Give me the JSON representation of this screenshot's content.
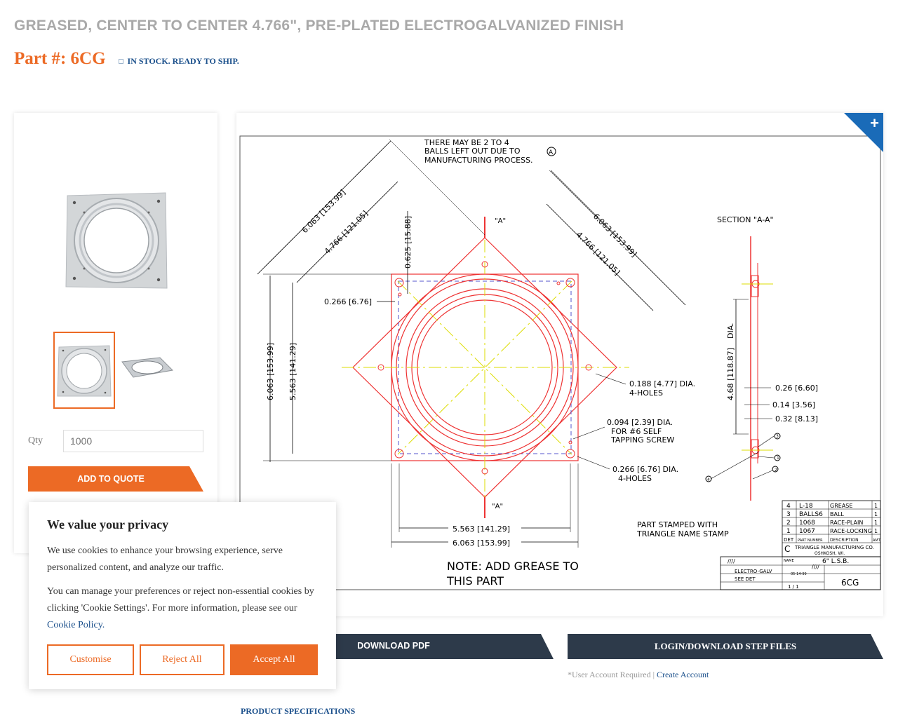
{
  "product": {
    "title": "GREASED, CENTER TO CENTER 4.766\", PRE-PLATED ELECTROGALVANIZED FINISH",
    "part_number": "Part #: 6CG",
    "stock_status": "IN STOCK. READY TO SHIP."
  },
  "purchase": {
    "qty_label": "Qty",
    "qty_placeholder": "1000",
    "quote_button": "ADD TO QUOTE"
  },
  "drawing": {
    "zoom_icon": "plus-icon",
    "note_top": [
      "THERE MAY BE 2 TO 4",
      "BALLS LEFT OUT DUE TO",
      "MANUFACTURING PROCESS."
    ],
    "note_top_ref": "A",
    "dim_6063_a": "6.063 [153.99]",
    "dim_4766_a": "4.766 [121.05]",
    "dim_0625": "0.625 [15.88]",
    "dim_6063_b": "6.063 [153.99]",
    "dim_4766_b": "4.766 [121.05]",
    "section_label": "SECTION \"A-A\"",
    "section_marker": "\"A\"",
    "dim_0266_left": "0.266 [6.76]",
    "dim_6063_v": "6.063 [153.99]",
    "dim_5563_v": "5.563 [141.29]",
    "dim_468": "4.68 [118.87]",
    "dia_label": "DIA.",
    "dim_026": "0.26 [6.60]",
    "dim_014": "0.14 [3.56]",
    "dim_032": "0.32 [8.13]",
    "hole_0188": [
      "0.188 [4.77] DIA.",
      "4-HOLES"
    ],
    "hole_0094": [
      "0.094 [2.39] DIA.",
      "FOR #6 SELF",
      "TAPPING SCREW"
    ],
    "hole_0266": [
      "0.266 [6.76] DIA.",
      "4-HOLES"
    ],
    "dim_5563_h": "5.563 [141.29]",
    "dim_6063_h": "6.063 [153.99]",
    "stamp_note": [
      "PART STAMPED WITH",
      "TRIANGLE NAME STAMP"
    ],
    "grease_note": [
      "NOTE: ADD GREASE TO",
      "THIS PART"
    ],
    "balloons": [
      "1",
      "2",
      "3",
      "4"
    ],
    "bom": [
      {
        "det": "4",
        "part": "L-18",
        "desc": "GREASE",
        "amt": "1"
      },
      {
        "det": "3",
        "part": "BALLS6",
        "desc": "BALL",
        "amt": "1"
      },
      {
        "det": "2",
        "part": "1068",
        "desc": "RACE-PLAIN",
        "amt": "1"
      },
      {
        "det": "1",
        "part": "1067",
        "desc": "RACE-LOCKING",
        "amt": "1"
      }
    ],
    "bom_headers": [
      "DET",
      "PART NUMBER",
      "DESCRIPTION",
      "AMT"
    ],
    "title_block": {
      "company": "TRIANGLE MANUFACTURING CO.",
      "city": "OSHKOSH, WI.",
      "logo_letter": "C",
      "name_label": "NAME",
      "name": "6\" L.S.B.",
      "plating": "ELECTRO-GALV",
      "material": "SEE DET",
      "date": "05-14-99",
      "part_no": "6CG",
      "scale": "1 / 1",
      "fit": "////",
      "used_in": "////"
    }
  },
  "downloads": {
    "pdf_button": "DOWNLOAD PDF",
    "step_button": "LOGIN/DOWNLOAD STEP FILES",
    "account_note": "*User Account Required | ",
    "create_account": "Create Account"
  },
  "specs_link": "PRODUCT SPECIFICATIONS",
  "cookie": {
    "title": "We value your privacy",
    "text1": "We use cookies to enhance your browsing experience, serve personalized content, and analyze our traffic.",
    "text2": "You can manage your preferences or reject non-essential cookies by clicking 'Cookie Settings'. For more information, please see our ",
    "policy_link": "Cookie Policy.",
    "customise": "Customise",
    "reject": "Reject All",
    "accept": "Accept All"
  },
  "colors": {
    "accent": "#ec6a25",
    "link": "#1a4f8b",
    "dark_button": "#2d3a4a",
    "zoom_corner": "#1a6bb8"
  }
}
